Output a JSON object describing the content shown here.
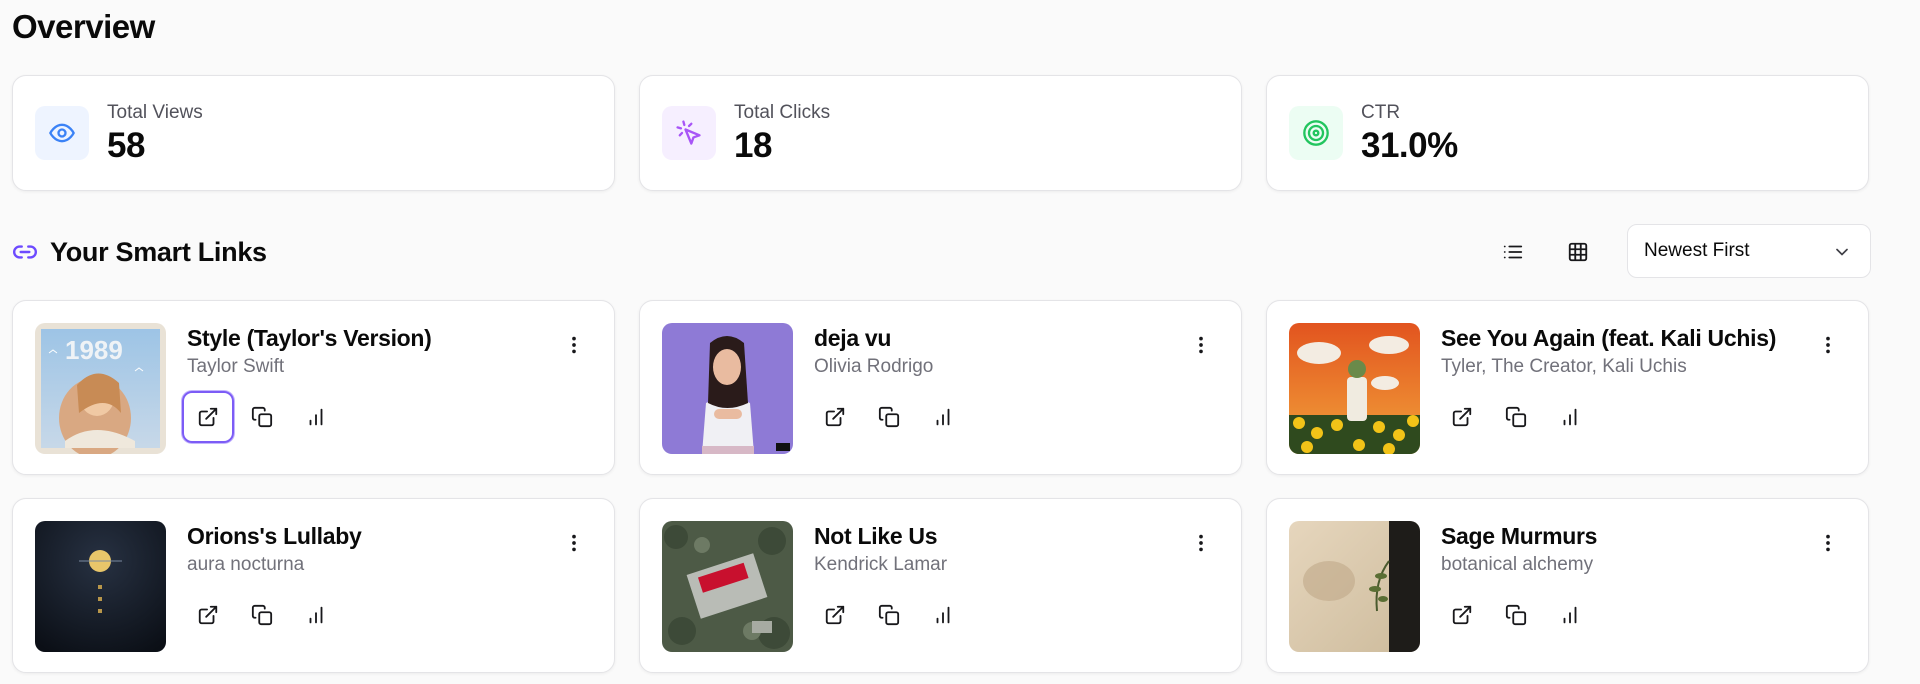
{
  "page": {
    "title": "Overview"
  },
  "stats": [
    {
      "label": "Total Views",
      "value": "58",
      "icon": "eye-icon",
      "bg": "#eef4ff",
      "color": "#3b82f6"
    },
    {
      "label": "Total Clicks",
      "value": "18",
      "icon": "cursor-click-icon",
      "bg": "#f6efff",
      "color": "#a855f7"
    },
    {
      "label": "CTR",
      "value": "31.0%",
      "icon": "target-icon",
      "bg": "#ecfdf3",
      "color": "#22c55e"
    }
  ],
  "links_section": {
    "title": "Your Smart Links",
    "icon": "link-icon",
    "accent": "#6d4aff",
    "view_list_icon": "list-view-icon",
    "view_grid_icon": "grid-view-icon",
    "sort_value": "Newest First"
  },
  "links": [
    {
      "title": "Style (Taylor's Version)",
      "artist": "Taylor Swift",
      "cover_text": "1989"
    },
    {
      "title": "deja vu",
      "artist": "Olivia Rodrigo"
    },
    {
      "title": "See You Again (feat. Kali Uchis)",
      "artist": "Tyler, The Creator, Kali Uchis"
    },
    {
      "title": "Orions's Lullaby",
      "artist": "aura nocturna"
    },
    {
      "title": "Not Like Us",
      "artist": "Kendrick Lamar"
    },
    {
      "title": "Sage Murmurs",
      "artist": "botanical alchemy"
    }
  ]
}
